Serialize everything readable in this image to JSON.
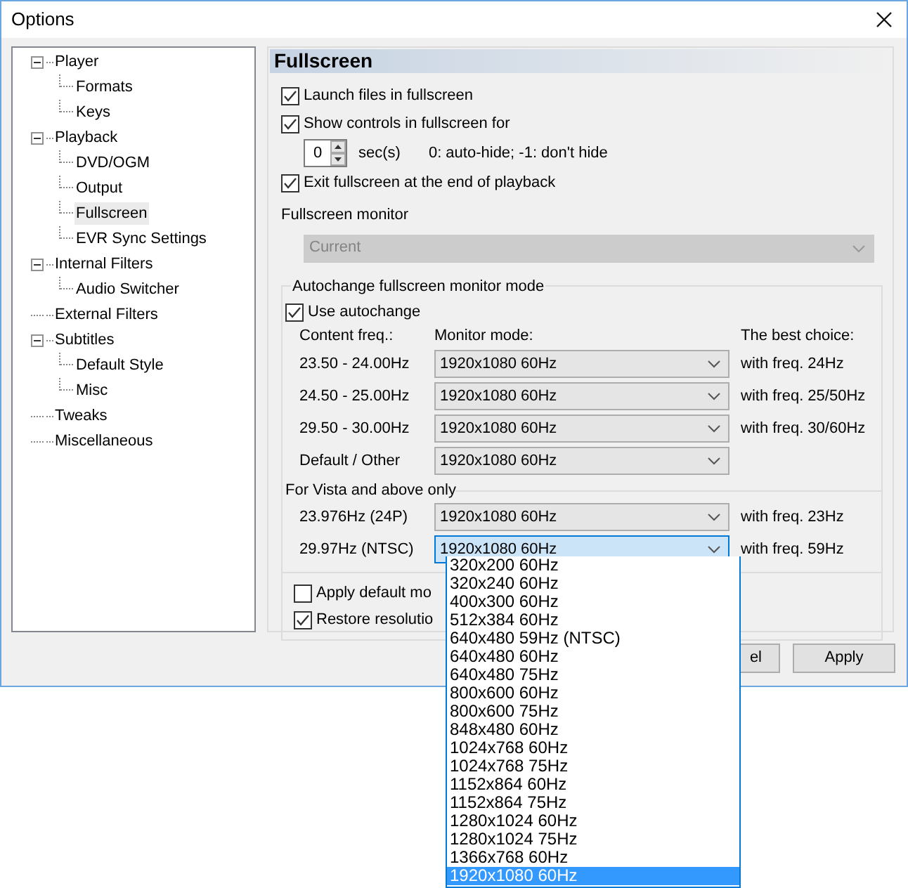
{
  "window": {
    "title": "Options"
  },
  "tree": [
    {
      "label": "Player",
      "expanded": true,
      "selected": false,
      "children": [
        {
          "label": "Formats",
          "selected": false
        },
        {
          "label": "Keys",
          "selected": false
        }
      ]
    },
    {
      "label": "Playback",
      "expanded": true,
      "selected": false,
      "children": [
        {
          "label": "DVD/OGM",
          "selected": false
        },
        {
          "label": "Output",
          "selected": false
        },
        {
          "label": "Fullscreen",
          "selected": true
        },
        {
          "label": "EVR Sync Settings",
          "selected": false
        }
      ]
    },
    {
      "label": "Internal Filters",
      "expanded": true,
      "selected": false,
      "children": [
        {
          "label": "Audio Switcher",
          "selected": false
        }
      ]
    },
    {
      "label": "External Filters",
      "selected": false
    },
    {
      "label": "Subtitles",
      "expanded": true,
      "selected": false,
      "children": [
        {
          "label": "Default Style",
          "selected": false
        },
        {
          "label": "Misc",
          "selected": false
        }
      ]
    },
    {
      "label": "Tweaks",
      "selected": false
    },
    {
      "label": "Miscellaneous",
      "selected": false
    }
  ],
  "page": {
    "title": "Fullscreen",
    "launch": {
      "label": "Launch files in fullscreen",
      "checked": true
    },
    "show_controls": {
      "label": "Show controls in fullscreen for",
      "checked": true
    },
    "controls_time": {
      "value": "0",
      "unit": "sec(s)",
      "hint": "0: auto-hide; -1: don't hide"
    },
    "exit": {
      "label": "Exit fullscreen at the end of playback",
      "checked": true
    },
    "monitor": {
      "label": "Fullscreen monitor",
      "value": "Current",
      "disabled": true
    },
    "autochange": {
      "title": "Autochange fullscreen monitor mode",
      "use": {
        "label": "Use autochange",
        "checked": true
      },
      "columns": [
        "Content freq.:",
        "Monitor mode:",
        "The best choice:"
      ],
      "rows": [
        {
          "freq": "23.50 - 24.00Hz",
          "mode": "1920x1080 60Hz",
          "best": "with freq. 24Hz",
          "open": false
        },
        {
          "freq": "24.50 - 25.00Hz",
          "mode": "1920x1080 60Hz",
          "best": "with freq. 25/50Hz",
          "open": false
        },
        {
          "freq": "29.50 - 30.00Hz",
          "mode": "1920x1080 60Hz",
          "best": "with freq. 30/60Hz",
          "open": false
        },
        {
          "freq": "Default / Other",
          "mode": "1920x1080 60Hz",
          "open": false
        }
      ],
      "vista_label": "For Vista and above only",
      "vista_rows": [
        {
          "freq": "23.976Hz (24P)",
          "mode": "1920x1080 60Hz",
          "best": "with freq. 23Hz",
          "open": false
        },
        {
          "freq": "29.97Hz (NTSC)",
          "mode": "1920x1080 60Hz",
          "best": "with freq. 59Hz",
          "open": true
        }
      ],
      "apply_default": {
        "label": "Apply default mo",
        "checked": false
      },
      "restore": {
        "label": "Restore resolutio",
        "checked": true
      }
    }
  },
  "dropdown": {
    "items": [
      {
        "label": "320x200 60Hz",
        "selected": false
      },
      {
        "label": "320x240 60Hz",
        "selected": false
      },
      {
        "label": "400x300 60Hz",
        "selected": false
      },
      {
        "label": "512x384 60Hz",
        "selected": false
      },
      {
        "label": "640x480 59Hz (NTSC)",
        "selected": false
      },
      {
        "label": "640x480 60Hz",
        "selected": false
      },
      {
        "label": "640x480 75Hz",
        "selected": false
      },
      {
        "label": "800x600 60Hz",
        "selected": false
      },
      {
        "label": "800x600 75Hz",
        "selected": false
      },
      {
        "label": "848x480 60Hz",
        "selected": false
      },
      {
        "label": "1024x768 60Hz",
        "selected": false
      },
      {
        "label": "1024x768 75Hz",
        "selected": false
      },
      {
        "label": "1152x864 60Hz",
        "selected": false
      },
      {
        "label": "1152x864 75Hz",
        "selected": false
      },
      {
        "label": "1280x1024 60Hz",
        "selected": false
      },
      {
        "label": "1280x1024 75Hz",
        "selected": false
      },
      {
        "label": "1366x768 60Hz",
        "selected": false
      },
      {
        "label": "1920x1080 60Hz",
        "selected": true
      }
    ]
  },
  "buttons": [
    {
      "label": "el"
    },
    {
      "label": "Apply"
    }
  ]
}
